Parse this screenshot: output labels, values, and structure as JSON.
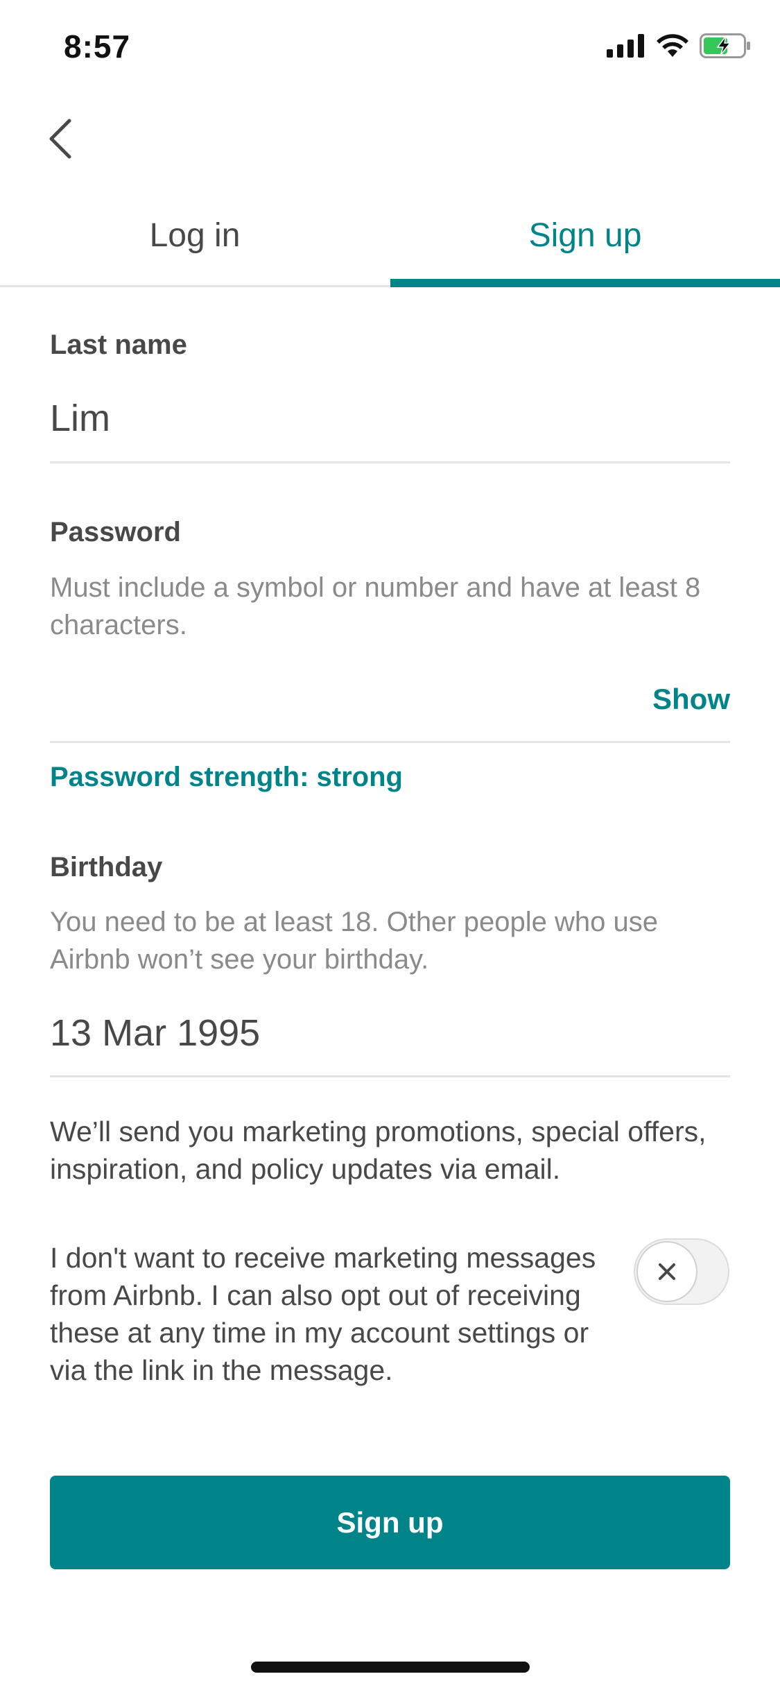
{
  "status_bar": {
    "time": "8:57",
    "icons": [
      "signal-icon",
      "wifi-icon",
      "battery-charging-icon"
    ]
  },
  "nav": {
    "back_icon": "chevron-left-icon"
  },
  "tabs": [
    {
      "label": "Log in",
      "selected": false
    },
    {
      "label": "Sign up",
      "selected": true
    }
  ],
  "form": {
    "last_name": {
      "label": "Last name",
      "value": "Lim"
    },
    "password": {
      "label": "Password",
      "helper": "Must include a symbol or number and have at least 8 characters.",
      "value": "",
      "show_label": "Show",
      "strength": "Password strength: strong"
    },
    "birthday": {
      "label": "Birthday",
      "helper": "You need to be at least 18. Other people who use Airbnb won’t see your birthday.",
      "value": "13 Mar 1995"
    },
    "marketing_notice": "We’ll send you marketing promotions, special offers, inspiration, and policy updates via email.",
    "opt_out": {
      "text": "I don't want to receive marketing messages from Airbnb. I can also opt out of receiving these at any time in my account settings or via the link in the message.",
      "checked": false,
      "icon": "close-icon"
    },
    "submit_label": "Sign up"
  },
  "colors": {
    "accent": "#008489",
    "text": "#484848",
    "muted": "#8a8a8a",
    "divider": "#e4e4e4"
  }
}
